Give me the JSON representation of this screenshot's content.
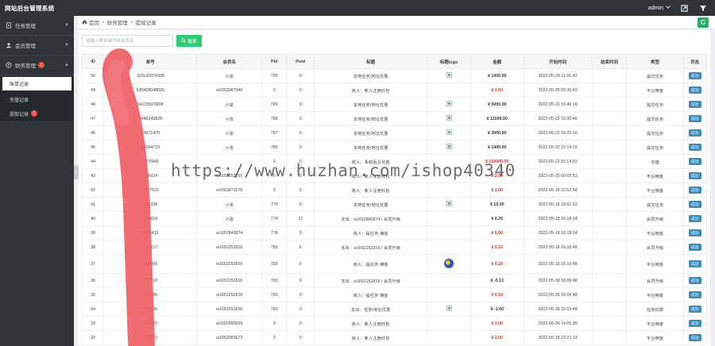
{
  "app": {
    "title": "网站后台管理系统"
  },
  "topbar": {
    "user": "admin"
  },
  "sidebar": {
    "groups": [
      {
        "label": "任务管理",
        "icon": "document-icon",
        "badge": ""
      },
      {
        "label": "会员管理",
        "icon": "users-icon",
        "badge": ""
      },
      {
        "label": "财务管理",
        "icon": "finance-icon",
        "badge": "1"
      }
    ],
    "sub_items": [
      {
        "label": "账单记录",
        "badge": ""
      },
      {
        "label": "充值记录",
        "badge": ""
      },
      {
        "label": "提现记录",
        "badge": "1"
      }
    ]
  },
  "breadcrumb": {
    "home": "首页",
    "section": "财务管理",
    "page": "提现记录"
  },
  "search": {
    "placeholder": "请输入账单编号或会员名",
    "button": "搜索"
  },
  "table": {
    "headers": [
      "ID",
      "单号",
      "会员名",
      "Pid",
      "Puid",
      "标题",
      "标题logo",
      "金额",
      "开始时间",
      "结束时间",
      "类型",
      "状态"
    ],
    "rows": [
      {
        "id": "50",
        "no": "110142074308",
        "member": "小张",
        "pid": "790",
        "puid": "0",
        "title": "本地任务/地址优惠",
        "logo": "broken",
        "amount": "¥ 1400.00",
        "amount_style": "dark",
        "start": "2022-05-29 11:41:42",
        "end": "",
        "type": "提交任务",
        "status": "成功"
      },
      {
        "id": "49",
        "no": "530408048025",
        "member": "w1653087040",
        "pid": "0",
        "puid": "0",
        "title": "收入：新人注册红包",
        "logo": "",
        "amount": "¥ 2.00",
        "amount_style": "red",
        "start": "2022-05-28 05:30:40",
        "end": "",
        "type": "平台佣金",
        "status": "成功"
      },
      {
        "id": "48",
        "no": "54229026808",
        "member": "小张",
        "pid": "789",
        "puid": "0",
        "title": "本地任务/地址优惠",
        "logo": "broken",
        "amount": "¥ 5000.00",
        "amount_style": "dark",
        "start": "2022-05-22 15:40:16",
        "end": "",
        "type": "提交任务",
        "status": "成功"
      },
      {
        "id": "47",
        "no": "5046243828",
        "member": "小张",
        "pid": "788",
        "puid": "0",
        "title": "本地任务/地址优惠",
        "logo": "broken",
        "amount": "¥ 12000.00",
        "amount_style": "dark",
        "start": "2022-05-22 15:30:46",
        "end": "",
        "type": "提交任务",
        "status": "成功"
      },
      {
        "id": "46",
        "no": "03671478",
        "member": "小张",
        "pid": "787",
        "puid": "0",
        "title": "本地任务/地址优惠",
        "logo": "broken",
        "amount": "¥ 3000.00",
        "amount_style": "dark",
        "start": "2022-05-22 15:20:10",
        "end": "",
        "type": "提交任务",
        "status": "成功"
      },
      {
        "id": "45",
        "no": "16064718",
        "member": "小张",
        "pid": "786",
        "puid": "0",
        "title": "本地任务/地址优惠",
        "logo": "broken",
        "amount": "¥ 1400.00",
        "amount_style": "dark",
        "start": "2022-05-22 15:14:16",
        "end": "",
        "type": "提交任务",
        "status": "成功"
      },
      {
        "id": "44",
        "no": "1075948",
        "member": "",
        "pid": "0",
        "puid": "0",
        "title": "收入：系统后台充值",
        "logo": "",
        "amount": "¥ 100000.00",
        "amount_style": "red",
        "start": "2022-05-22 15:14:01",
        "end": "",
        "type": "充值",
        "status": "成功"
      },
      {
        "id": "43",
        "no": "025024",
        "member": "w1652852701",
        "pid": "0",
        "puid": "0",
        "title": "收入：新人注册红包",
        "logo": "",
        "amount": "¥ 2.00",
        "amount_style": "red",
        "start": "2022-05-20 00:05:51",
        "end": "",
        "type": "平台佣金",
        "status": "成功"
      },
      {
        "id": "42",
        "no": "0087523",
        "member": "w1652871078",
        "pid": "0",
        "puid": "0",
        "title": "收入：新人注册红包",
        "logo": "",
        "amount": "¥ 2.00",
        "amount_style": "red",
        "start": "2022-05-18 22:52:58",
        "end": "",
        "type": "平台佣金",
        "status": "成功"
      },
      {
        "id": "41",
        "no": "121338",
        "member": "小张",
        "pid": "779",
        "puid": "0",
        "title": "本地任务/地址优惠",
        "logo": "broken",
        "amount": "¥ 10.00",
        "amount_style": "dark",
        "start": "2022-05-18 18:01:52",
        "end": "",
        "type": "提交任务",
        "status": "成功"
      },
      {
        "id": "40",
        "no": "760818",
        "member": "小张",
        "pid": "779",
        "puid": "12",
        "title": "支出：w1652845874 / 会员升级",
        "logo": "",
        "amount": "¥ 6.25",
        "amount_style": "dark",
        "start": "2022-05-18 16:18:34",
        "end": "",
        "type": "会员升级",
        "status": "成功"
      },
      {
        "id": "39",
        "no": "6364412",
        "member": "w1652845874",
        "pid": "778",
        "puid": "0",
        "title": "收入：提任务·佣金",
        "logo": "",
        "amount": "¥ 5.00",
        "amount_style": "red",
        "start": "2022-05-18 16:18:34",
        "end": "",
        "type": "平台佣金",
        "status": "成功"
      },
      {
        "id": "38",
        "no": "313617",
        "member": "w1652252816",
        "pid": "789",
        "puid": "6",
        "title": "支出：w1652252816 / 会员升级",
        "logo": "",
        "amount": "¥ 0.10",
        "amount_style": "red",
        "start": "2022-05-18 16:16:48",
        "end": "",
        "type": "会员升级",
        "status": "成功"
      },
      {
        "id": "37",
        "no": "502406",
        "member": "w1652252816",
        "pid": "789",
        "puid": "6",
        "title": "收入：提任务·佣金",
        "logo": "circle",
        "amount": "¥ 0.10",
        "amount_style": "red",
        "start": "2022-05-18 16:16:48",
        "end": "",
        "type": "平台佣金",
        "status": "成功",
        "tall": true
      },
      {
        "id": "36",
        "no": "137216",
        "member": "w1652252816",
        "pid": "783",
        "puid": "6",
        "title": "支出：w1652252816 / 会员升级",
        "logo": "",
        "amount": "¥ -0.13",
        "amount_style": "dark",
        "start": "2022-05-39 16:06:48",
        "end": "",
        "type": "会员升级",
        "status": "成功"
      },
      {
        "id": "35",
        "no": "190786",
        "member": "w1652252816",
        "pid": "783",
        "puid": "0",
        "title": "收入：提任务·佣金",
        "logo": "",
        "amount": "¥ 0.10",
        "amount_style": "red",
        "start": "2022-05-39 16:06:48",
        "end": "",
        "type": "平台佣金",
        "status": "成功"
      },
      {
        "id": "34",
        "no": "800236",
        "member": "w1652252816",
        "pid": "783",
        "puid": "0",
        "title": "支出：任务/地址优惠",
        "logo": "broken",
        "amount": "¥ -1.00",
        "amount_style": "dark",
        "start": "2022-05-39 15:53:48",
        "end": "",
        "type": "任务扣费",
        "status": "成功"
      },
      {
        "id": "33",
        "no": "806022",
        "member": "w1652585839",
        "pid": "0",
        "puid": "0",
        "title": "收入：新人注册红包",
        "logo": "",
        "amount": "¥ 2.00",
        "amount_style": "red",
        "start": "2022-05-39 14:05:39",
        "end": "",
        "type": "平台佣金",
        "status": "成功"
      },
      {
        "id": "32",
        "no": "272923",
        "member": "w1652983673",
        "pid": "0",
        "puid": "0",
        "title": "收入：新人注册红包",
        "logo": "",
        "amount": "¥ 2.00",
        "amount_style": "red",
        "start": "2022-05-18 22:21:13",
        "end": "",
        "type": "平台佣金",
        "status": "成功"
      }
    ]
  },
  "watermark": "https://www.huzhan.com/ishop40340",
  "colors": {
    "sidebar_bg": "#2f3439",
    "accent_green": "#2ecc71",
    "status_blue": "#3c8dbc",
    "amount_red": "#d0332c",
    "brush": "#ef5b63"
  }
}
